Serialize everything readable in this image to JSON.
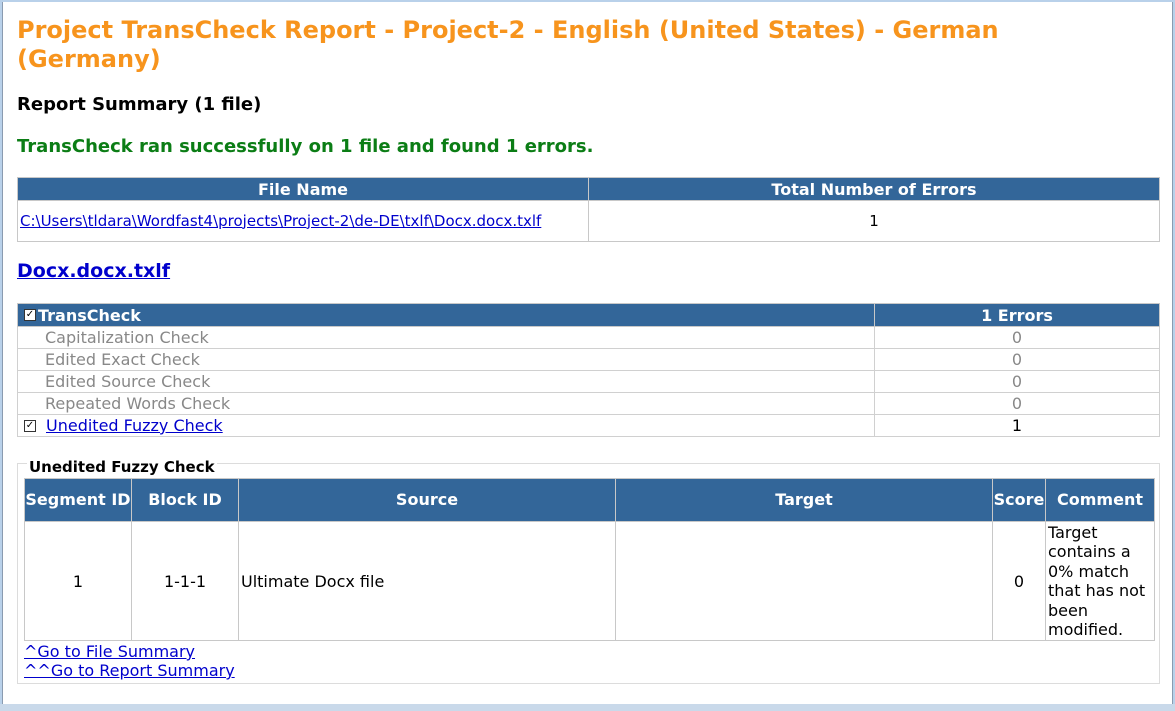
{
  "report": {
    "title": "Project TransCheck Report - Project-2 - English (United States) - German (Germany)",
    "summary_heading": "Report Summary (1 file)",
    "success_message": "TransCheck ran successfully on 1 file and found 1 errors."
  },
  "file_table": {
    "headers": [
      "File Name",
      "Total Number of Errors"
    ],
    "rows": [
      {
        "file_path": "C:\\Users\\tldara\\Wordfast4\\projects\\Project-2\\de-DE\\txlf\\Docx.docx.txlf",
        "errors": "1"
      }
    ]
  },
  "file_section": {
    "heading": "Docx.docx.txlf"
  },
  "checks_table": {
    "header_label": "TransCheck",
    "header_count": "1 Errors",
    "rows": [
      {
        "label": "Capitalization Check",
        "count": "0"
      },
      {
        "label": "Edited Exact Check",
        "count": "0"
      },
      {
        "label": "Edited Source Check",
        "count": "0"
      },
      {
        "label": "Repeated Words Check",
        "count": "0"
      },
      {
        "label": "Unedited Fuzzy Check",
        "count": "1"
      }
    ]
  },
  "fuzzy_section": {
    "legend": "Unedited Fuzzy Check",
    "headers": {
      "segment_id": "Segment ID",
      "block_id": "Block ID",
      "source": "Source",
      "target": "Target",
      "score": "Score",
      "comment": "Comment"
    },
    "rows": [
      {
        "segment_id": "1",
        "block_id": "1-1-1",
        "source": "Ultimate Docx file",
        "target": "",
        "score": "0",
        "comment": "Target contains a 0% match that has not been modified."
      }
    ],
    "link_file_summary": "^Go to File Summary",
    "link_report_summary": "^^Go to Report Summary"
  }
}
